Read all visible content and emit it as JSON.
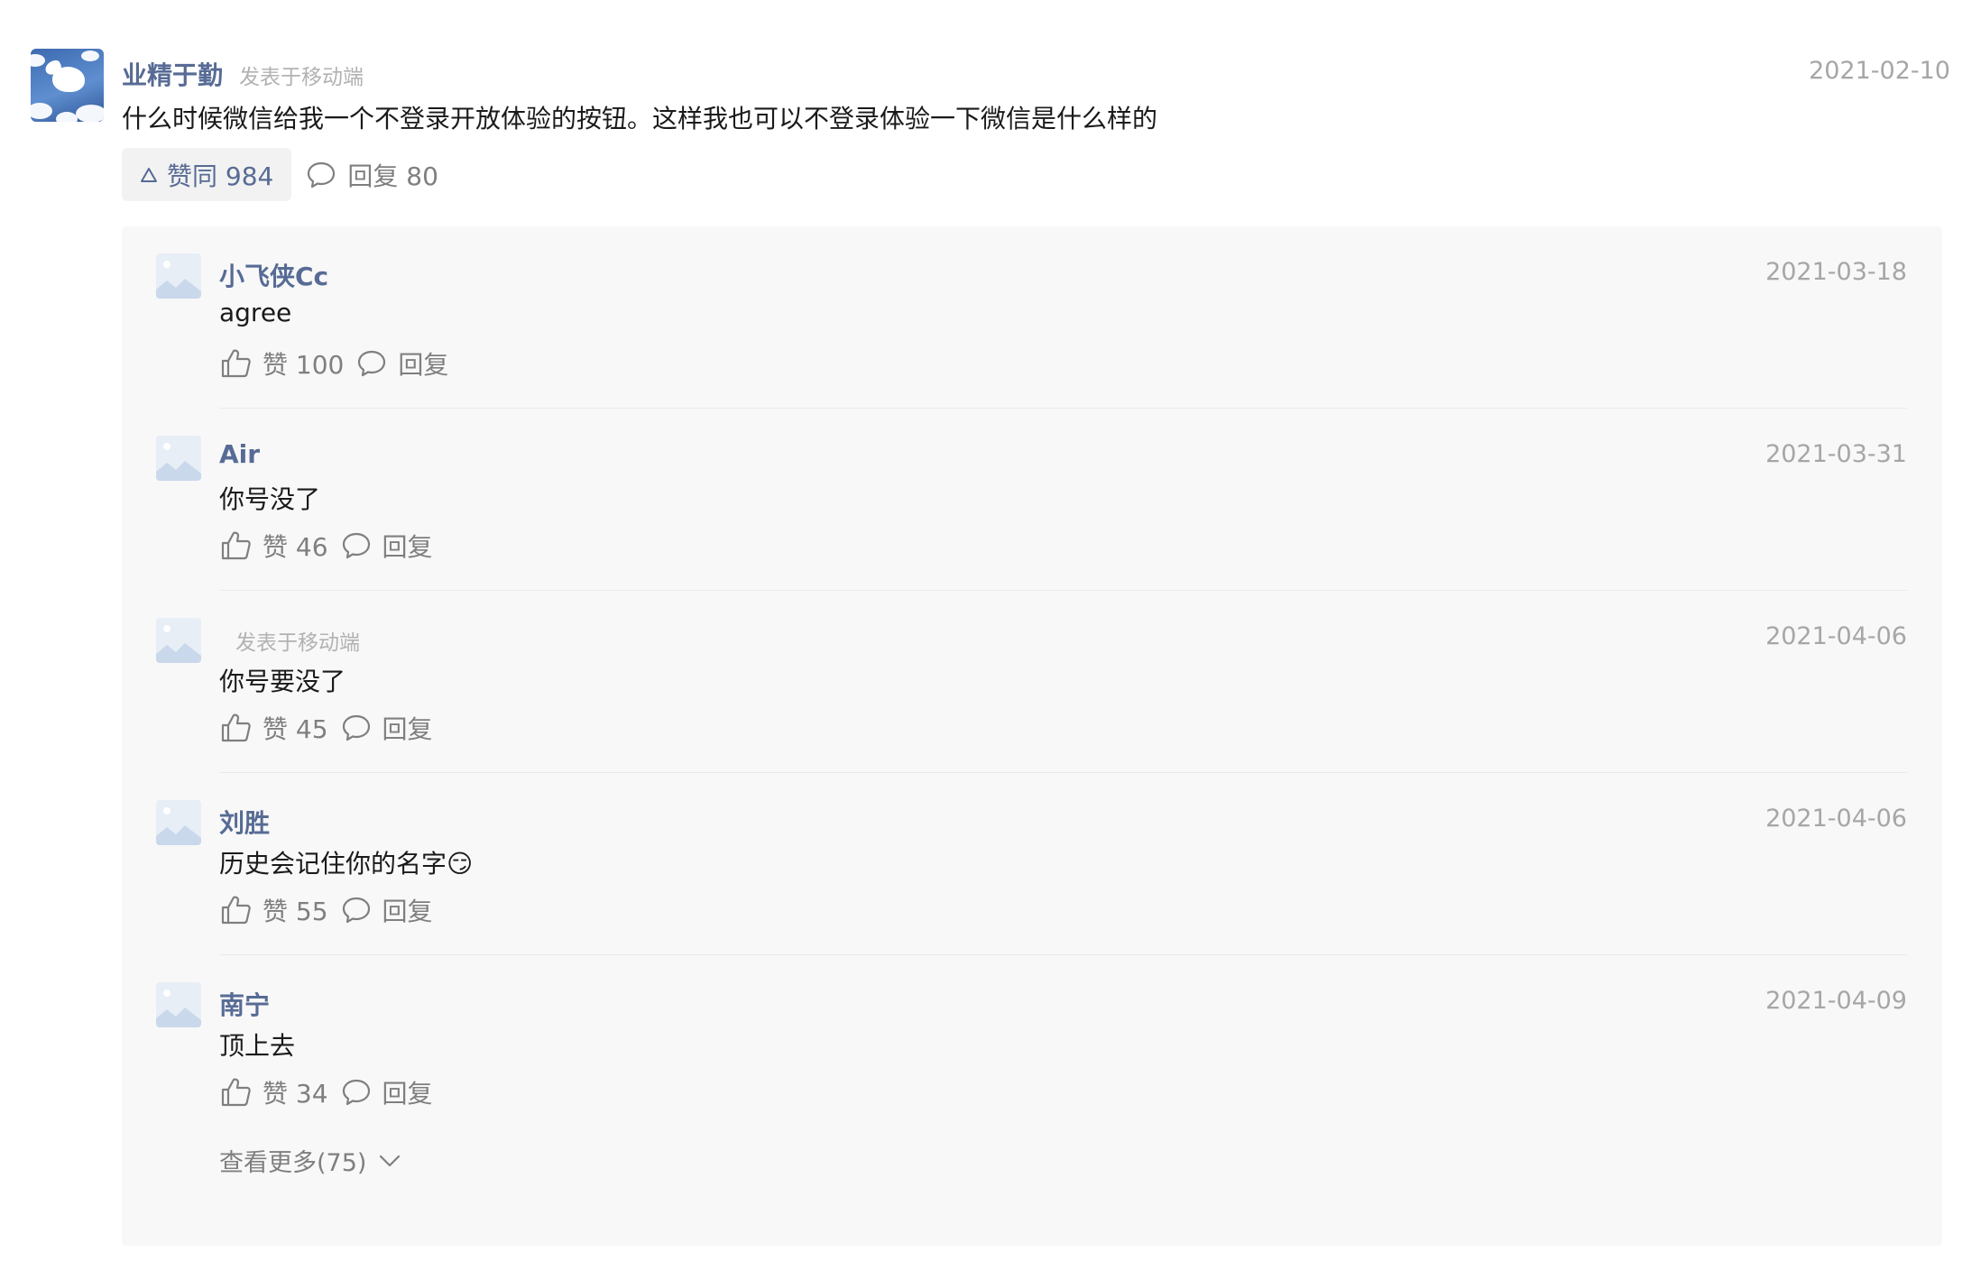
{
  "main_comment": {
    "author": "业精于勤",
    "source": "发表于移动端",
    "date": "2021-02-10",
    "text": "什么时候微信给我一个不登录开放体验的按钮。这样我也可以不登录体验一下微信是什么样的",
    "like_label": "赞同 984",
    "reply_label": "回复 80",
    "avatar_icon": "flying-pig-clouds-avatar",
    "colors": {
      "name": "#576b95",
      "meta": "#a6a6a6",
      "like_bg": "#f2f2f2"
    }
  },
  "replies": [
    {
      "author": "小飞侠Cc",
      "source": "",
      "date": "2021-03-18",
      "text": "agree",
      "likes_label": "赞 100",
      "reply_label": "回复"
    },
    {
      "author": "Air",
      "source": "",
      "date": "2021-03-31",
      "text": "你号没了",
      "likes_label": "赞 46",
      "reply_label": "回复"
    },
    {
      "author": "",
      "source": "发表于移动端",
      "date": "2021-04-06",
      "text": "你号要没了",
      "likes_label": "赞 45",
      "reply_label": "回复"
    },
    {
      "author": "刘胜",
      "source": "",
      "date": "2021-04-06",
      "text": "历史会记住你的名字😏",
      "likes_label": "赞 55",
      "reply_label": "回复"
    },
    {
      "author": "南宁",
      "source": "",
      "date": "2021-04-09",
      "text": "顶上去",
      "likes_label": "赞 34",
      "reply_label": "回复"
    }
  ],
  "view_more_label": "查看更多(75)",
  "icons": {
    "like": "thumbs-up-icon",
    "reply": "comment-bubble-icon",
    "upvote": "triangle-up-icon",
    "expand": "chevron-down-icon",
    "avatar_placeholder": "image-placeholder-icon"
  }
}
